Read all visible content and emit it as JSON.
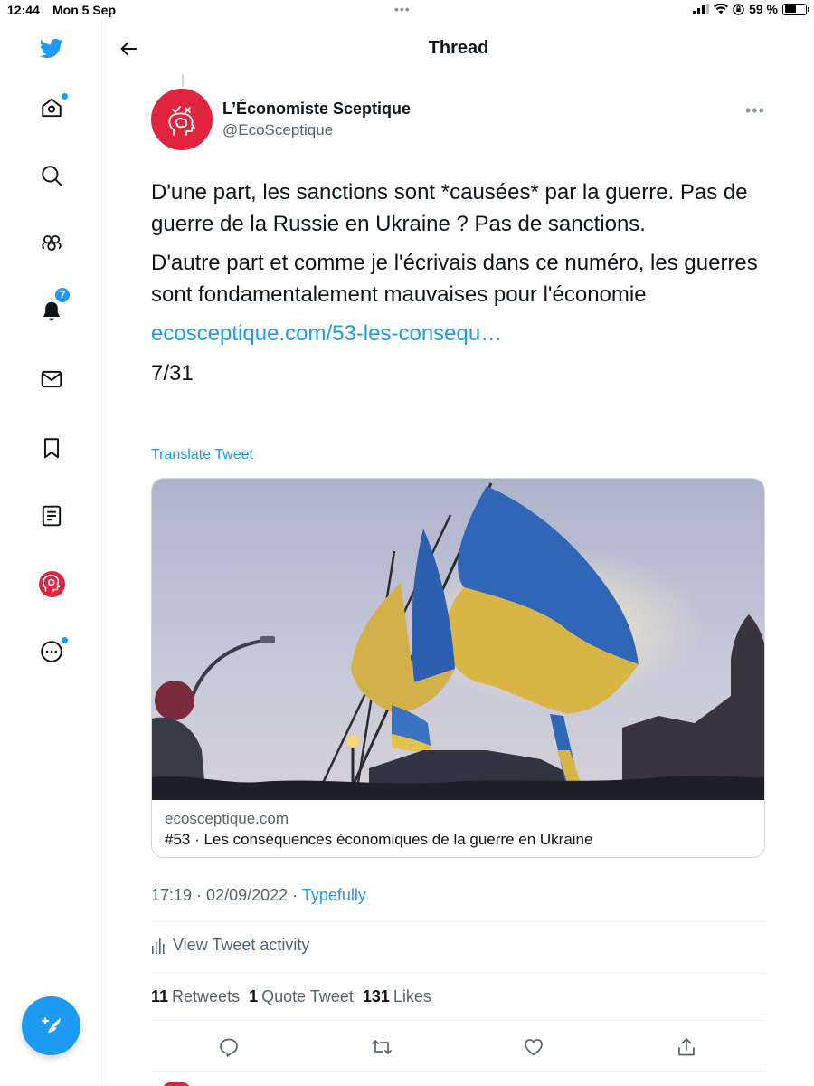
{
  "status_bar": {
    "time": "12:44",
    "date": "Mon 5 Sep",
    "battery": "59 %",
    "battery_level": 0.59
  },
  "sidebar": {
    "items": [
      {
        "name": "twitter-logo-icon"
      },
      {
        "name": "home-icon",
        "dot": true
      },
      {
        "name": "search-icon"
      },
      {
        "name": "communities-icon"
      },
      {
        "name": "notifications-icon",
        "badge": "7"
      },
      {
        "name": "messages-icon"
      },
      {
        "name": "bookmarks-icon"
      },
      {
        "name": "lists-icon"
      },
      {
        "name": "profile-avatar"
      },
      {
        "name": "more-icon",
        "dot": true
      }
    ],
    "compose_icon": "compose-feather-icon"
  },
  "header": {
    "title": "Thread"
  },
  "tweet": {
    "display_name": "L’Économiste Sceptique",
    "handle": "@EcoSceptique",
    "paragraphs": [
      "D'une part, les sanctions sont *causées* par la guerre. Pas de guerre de la Russie en Ukraine ? Pas de sanctions.",
      "D'autre part et comme je l'écrivais dans ce numéro, les guerres sont fondamentalement mauvaises pour l'économie"
    ],
    "link": "ecosceptique.com/53-les-consequ…",
    "thread_count": "7/31",
    "translate_label": "Translate Tweet",
    "card": {
      "domain": "ecosceptique.com",
      "title": "#53 · Les conséquences économiques de la guerre en Ukraine"
    },
    "time": "17:19",
    "date": "02/09/2022",
    "separator": " · ",
    "source": "Typefully",
    "activity_label": "View Tweet activity",
    "stats": {
      "retweets_count": "11",
      "retweets_label": "Retweets",
      "quotes_count": "1",
      "quotes_label": "Quote Tweet",
      "likes_count": "131",
      "likes_label": "Likes"
    }
  },
  "colors": {
    "accent": "#1d9bf0",
    "avatar_red": "#e0243d",
    "text_secondary": "#536471"
  }
}
